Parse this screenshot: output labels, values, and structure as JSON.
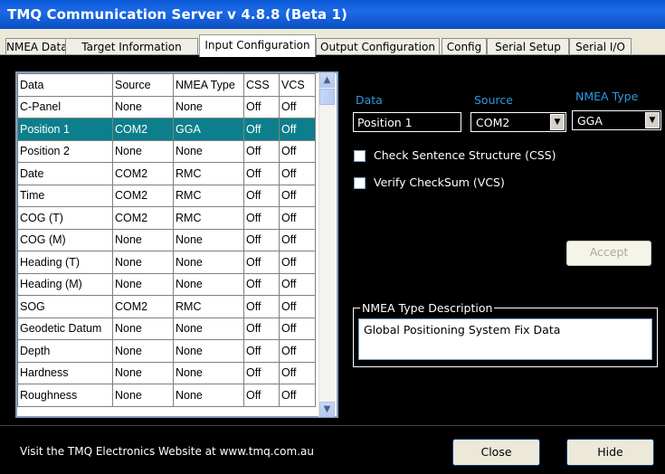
{
  "window": {
    "title": "TMQ Communication Server v 4.8.8 (Beta 1)"
  },
  "tabs": [
    {
      "label": "NMEA Data"
    },
    {
      "label": "Target Information"
    },
    {
      "label": "Input Configuration"
    },
    {
      "label": "Output Configuration"
    },
    {
      "label": "Config"
    },
    {
      "label": "Serial Setup"
    },
    {
      "label": "Serial I/O"
    }
  ],
  "grid": {
    "headers": [
      "Data",
      "Source",
      "NMEA Type",
      "CSS",
      "VCS"
    ],
    "selected_row": 1,
    "rows": [
      [
        "C-Panel",
        "None",
        "None",
        "Off",
        "Off"
      ],
      [
        "Position 1",
        "COM2",
        "GGA",
        "Off",
        "Off"
      ],
      [
        "Position 2",
        "None",
        "None",
        "Off",
        "Off"
      ],
      [
        "Date",
        "COM2",
        "RMC",
        "Off",
        "Off"
      ],
      [
        "Time",
        "COM2",
        "RMC",
        "Off",
        "Off"
      ],
      [
        "COG (T)",
        "COM2",
        "RMC",
        "Off",
        "Off"
      ],
      [
        "COG (M)",
        "None",
        "None",
        "Off",
        "Off"
      ],
      [
        "Heading (T)",
        "None",
        "None",
        "Off",
        "Off"
      ],
      [
        "Heading (M)",
        "None",
        "None",
        "Off",
        "Off"
      ],
      [
        "SOG",
        "COM2",
        "RMC",
        "Off",
        "Off"
      ],
      [
        "Geodetic Datum",
        "None",
        "None",
        "Off",
        "Off"
      ],
      [
        "Depth",
        "None",
        "None",
        "Off",
        "Off"
      ],
      [
        "Hardness",
        "None",
        "None",
        "Off",
        "Off"
      ],
      [
        "Roughness",
        "None",
        "None",
        "Off",
        "Off"
      ]
    ]
  },
  "editor": {
    "data_label": "Data",
    "source_label": "Source",
    "nmea_type_label": "NMEA Type",
    "data_value": "Position 1",
    "source_value": "COM2",
    "nmea_type_value": "GGA",
    "css_label": "Check Sentence Structure (CSS)",
    "vcs_label": "Verify CheckSum (VCS)",
    "accept_label": "Accept"
  },
  "description": {
    "title": "NMEA Type Description",
    "text": "Global Positioning System Fix Data"
  },
  "footer": {
    "website_text": "Visit the TMQ Electronics Website at www.tmq.com.au",
    "close_label": "Close",
    "hide_label": "Hide"
  },
  "colors": {
    "selection": "#0d7f8c",
    "label_accent": "#2c9ae0",
    "background": "#000000",
    "titlebar": "#0a5ad8"
  }
}
